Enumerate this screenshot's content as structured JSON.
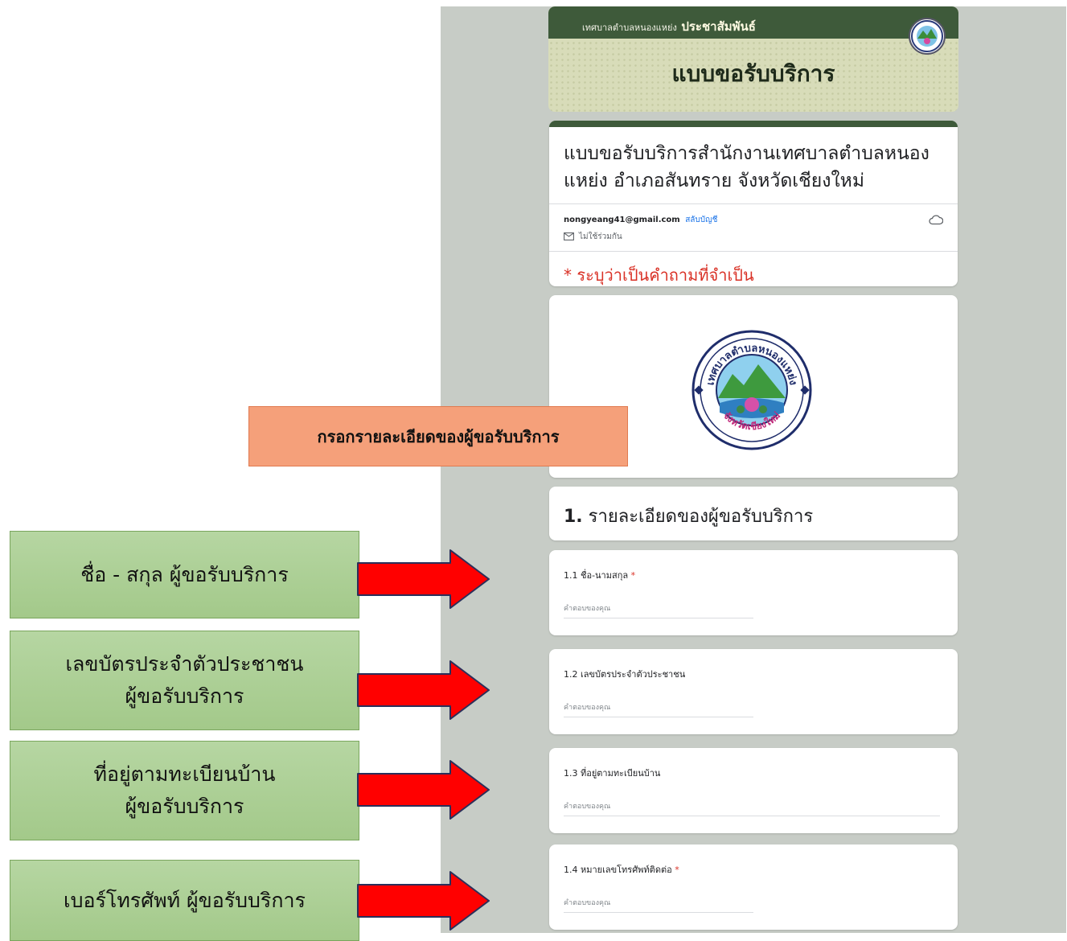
{
  "banner": {
    "org": "เทศบาลตำบลหนองแหย่ง",
    "pr": "ประชาสัมพันธ์",
    "title": "แบบขอรับบริการ"
  },
  "form": {
    "title": "แบบขอรับบริการสำนักงานเทศบาลตำบลหนองแหย่ง อำเภอสันทราย จังหวัดเชียงใหม่",
    "email": "nongyeang41@gmail.com",
    "switch_account": "สลับบัญชี",
    "not_shared": "ไม่ใช้ร่วมกัน",
    "required_note": "* ระบุว่าเป็นคำถามที่จำเป็น"
  },
  "seal": {
    "top_text": "เทศบาลตำบลหนองแหย่ง",
    "bottom_text": "จังหวัดเชียงใหม่"
  },
  "section": {
    "number": "1.",
    "title": "รายละเอียดของผู้ขอรับบริการ"
  },
  "questions": [
    {
      "label": "1.1 ชื่อ-นามสกุล",
      "required": "*",
      "placeholder": "คำตอบของคุณ"
    },
    {
      "label": "1.2 เลขบัตรประจำตัวประชาชน",
      "required": "",
      "placeholder": "คำตอบของคุณ"
    },
    {
      "label": "1.3 ที่อยู่ตามทะเบียนบ้าน",
      "required": "",
      "placeholder": "คำตอบของคุณ"
    },
    {
      "label": "1.4 หมายเลขโทรศัพท์ติดต่อ",
      "required": "*",
      "placeholder": "คำตอบของคุณ"
    }
  ],
  "callouts": {
    "orange": "กรอกรายละเอียดของผู้ขอรับบริการ",
    "green": [
      "ชื่อ - สกุล ผู้ขอรับบริการ",
      "เลขบัตรประจำตัวประชาชน\nผู้ขอรับบริการ",
      "ที่อยู่ตามทะเบียนบ้าน\nผู้ขอรับบริการ",
      "เบอร์โทรศัพท์ ผู้ขอรับบริการ"
    ]
  },
  "colors": {
    "banner_dark": "#3e5a3a",
    "required_red": "#d93025",
    "link_blue": "#1a73e8",
    "arrow_red": "#ff0000",
    "callout_green": "#a9cf92",
    "callout_orange": "#f5a07a"
  },
  "icons": [
    "cloud-icon",
    "mail-icon",
    "seal-logo"
  ]
}
